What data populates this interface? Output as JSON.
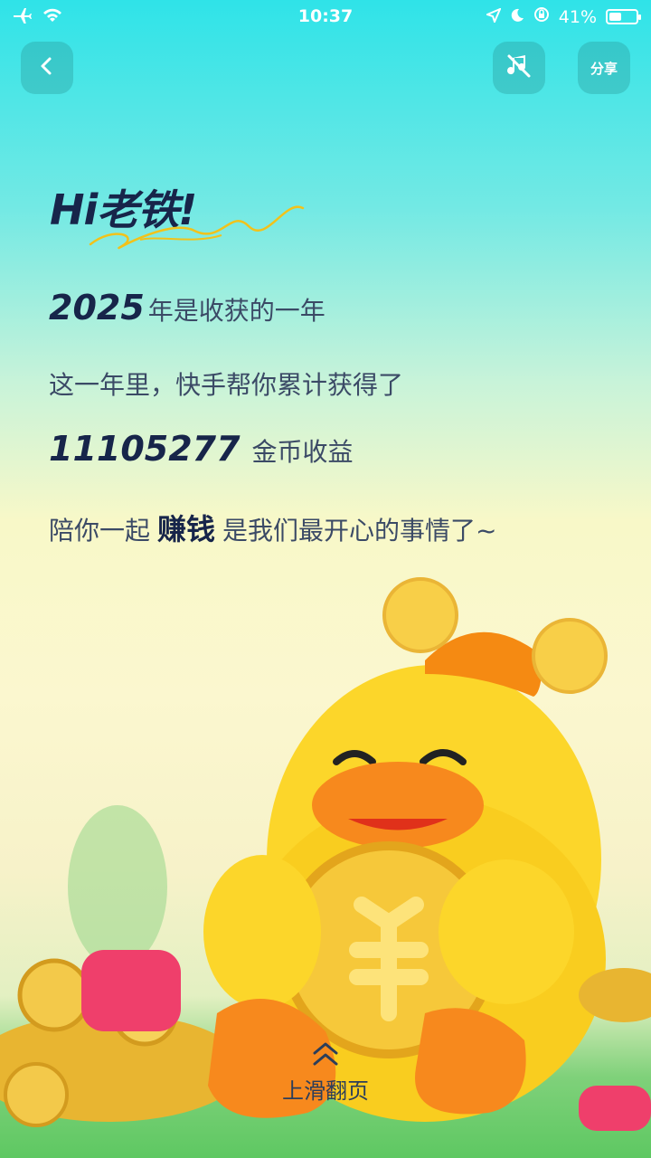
{
  "status": {
    "time": "10:37",
    "battery": "41%"
  },
  "nav": {
    "share_label": "分享"
  },
  "greeting": "Hi老铁!",
  "year_line": {
    "year": "2025",
    "text": "年是收获的一年"
  },
  "line2": "这一年里，快手帮你累计获得了",
  "coins_line": {
    "amount": "11105277",
    "text": "金币收益"
  },
  "last_line": {
    "prefix": "陪你一起",
    "emphasis": "赚钱",
    "suffix": "是我们最开心的事情了~"
  },
  "hint": "上滑翻页"
}
